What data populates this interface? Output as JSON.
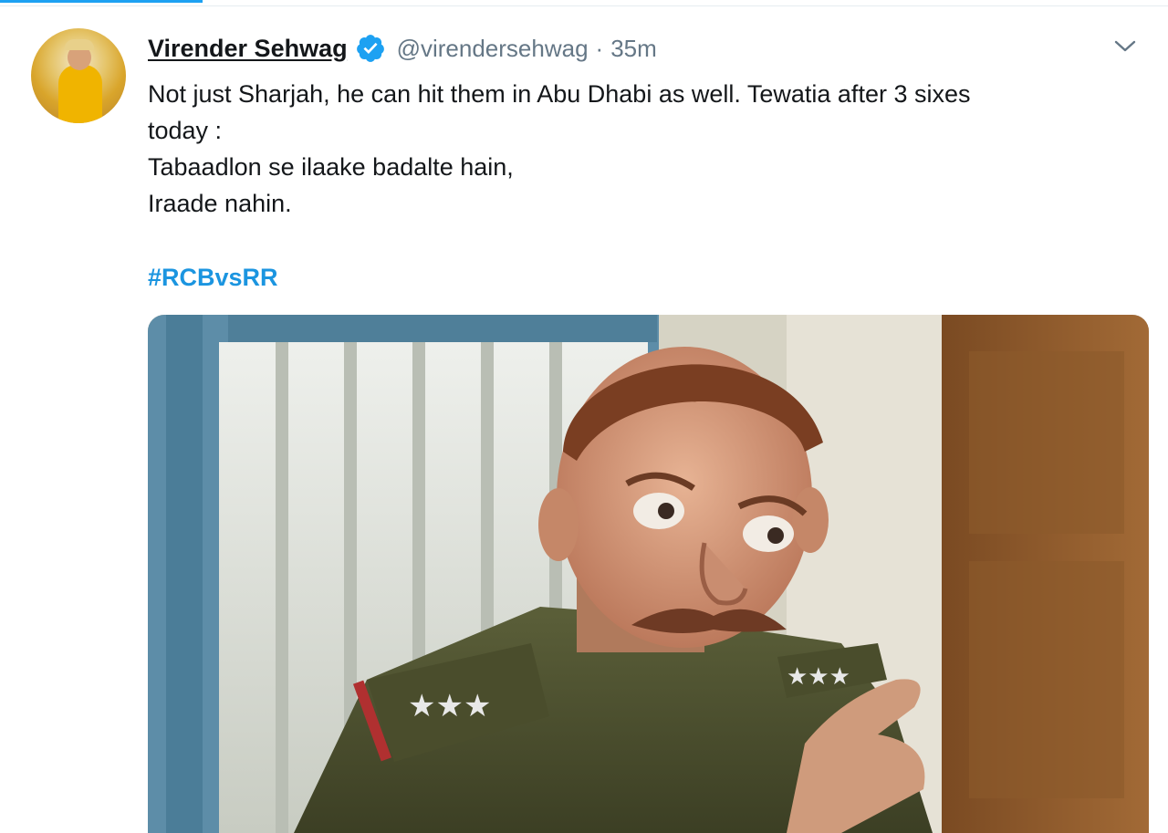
{
  "tweet": {
    "display_name": "Virender Sehwag",
    "handle": "@virendersehwag",
    "separator": "·",
    "time": "35m",
    "text_lines": [
      "Not just Sharjah, he can hit them in Abu Dhabi as well. Tewatia after 3 sixes",
      "today :",
      "Tabaadlon se ilaake badalte hain,",
      "Iraade nahin."
    ],
    "hashtag": "#RCBvsRR"
  },
  "icons": {
    "verified": "verified-badge-icon",
    "more": "chevron-down-icon"
  },
  "colors": {
    "accent": "#1da1f2",
    "hashtag": "#1b95e0",
    "text": "#14171a",
    "secondary": "#657786"
  }
}
